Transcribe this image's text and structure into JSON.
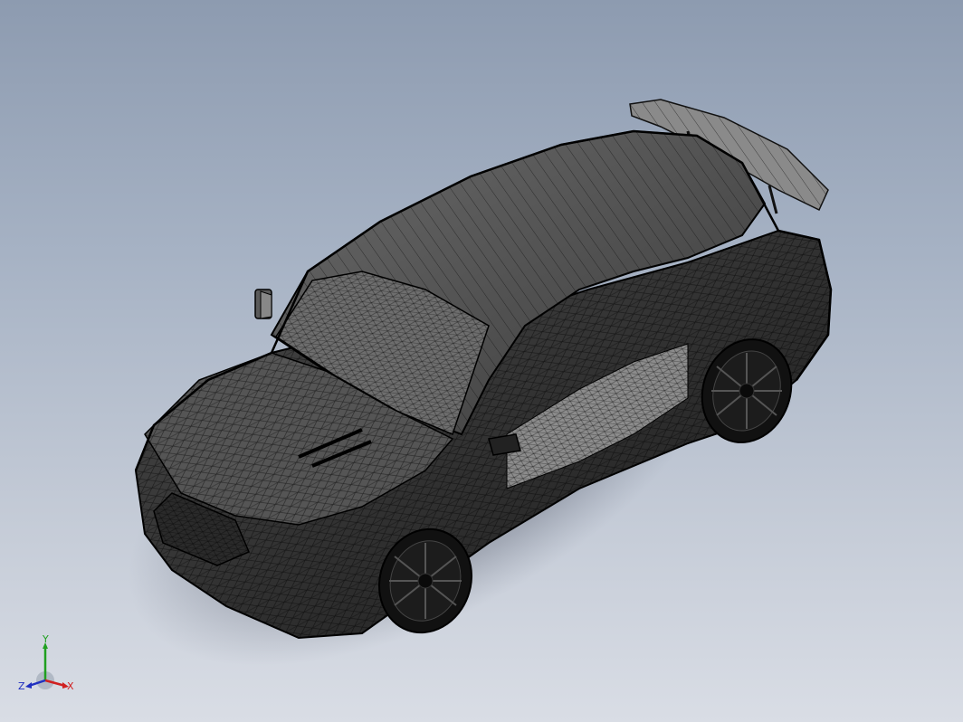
{
  "viewport": {
    "background_top": "#8d9bb0",
    "background_bottom": "#d9dde5",
    "display_style": "shaded-with-edges",
    "model": {
      "subject": "car-body-wireframe",
      "body_color": "#3c3c3c",
      "edge_color": "#050505"
    }
  },
  "triad": {
    "x_label": "X",
    "y_label": "Y",
    "z_label": "Z",
    "x_color": "#d02020",
    "y_color": "#20a020",
    "z_color": "#2030c0"
  }
}
